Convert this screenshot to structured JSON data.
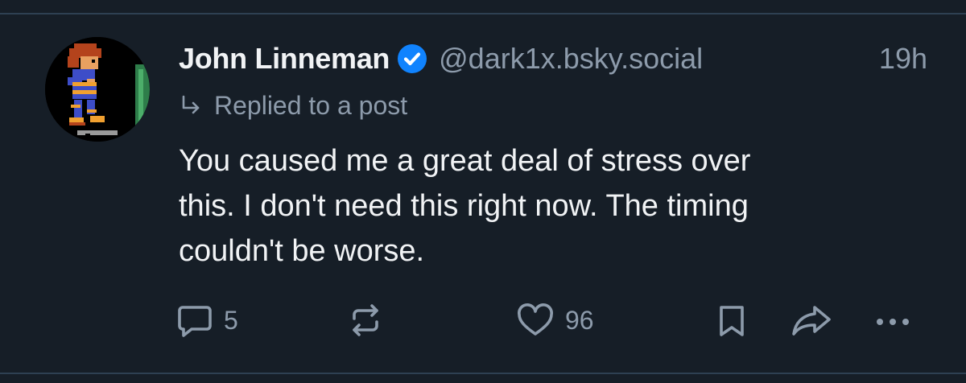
{
  "post": {
    "author": {
      "display_name": "John Linneman",
      "handle": "@dark1x.bsky.social",
      "verified": true,
      "avatar_icon": "pixel-art-avatar"
    },
    "timestamp": "19h",
    "reply_context": {
      "icon": "reply-arrow-icon",
      "label": "Replied to a post"
    },
    "text": "You caused me a great deal of stress over\nthis. I don't need this right now. The timing\ncouldn't be worse.",
    "actions": {
      "reply": {
        "icon": "comment-icon",
        "count": "5"
      },
      "repost": {
        "icon": "repost-icon",
        "count": ""
      },
      "like": {
        "icon": "heart-icon",
        "count": "96"
      },
      "bookmark": {
        "icon": "bookmark-icon"
      },
      "share": {
        "icon": "share-icon"
      },
      "more": {
        "icon": "more-icon"
      }
    }
  },
  "colors": {
    "background": "#161e27",
    "divider": "#2e4052",
    "text_primary": "#f1f3f5",
    "text_secondary": "#8d9bab",
    "verified_badge": "#1083fe"
  }
}
